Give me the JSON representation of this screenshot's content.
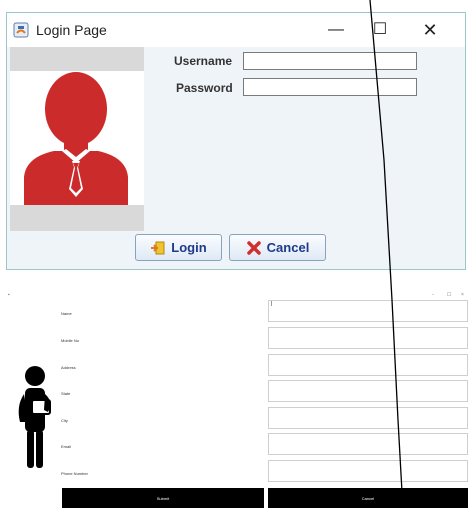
{
  "login": {
    "title": "Login Page",
    "username_label": "Username",
    "password_label": "Password",
    "username_value": "",
    "password_value": "",
    "login_label": "Login",
    "cancel_label": "Cancel",
    "window_controls": {
      "minimize": "—",
      "maximize": "☐",
      "close": "✕"
    }
  },
  "register": {
    "fields": [
      {
        "label": "Name",
        "value": "|"
      },
      {
        "label": "Mobile No",
        "value": ""
      },
      {
        "label": "Address",
        "value": ""
      },
      {
        "label": "State",
        "value": ""
      },
      {
        "label": "City",
        "value": ""
      },
      {
        "label": "Email",
        "value": ""
      },
      {
        "label": "Phone Number",
        "value": ""
      }
    ],
    "submit_label": "Submit",
    "cancel_label": "Cancel",
    "window_controls": {
      "minimize": "-",
      "maximize": "☐",
      "close": "×"
    }
  },
  "colors": {
    "avatar_red": "#cc2b2b",
    "window_border": "#9cc7c9",
    "button_text": "#1e3a8a",
    "cancel_x": "#d22f2f"
  },
  "icons": [
    "java-app-icon",
    "user-avatar-icon",
    "login-arrow-icon",
    "cancel-x-icon",
    "person-figure-icon"
  ]
}
